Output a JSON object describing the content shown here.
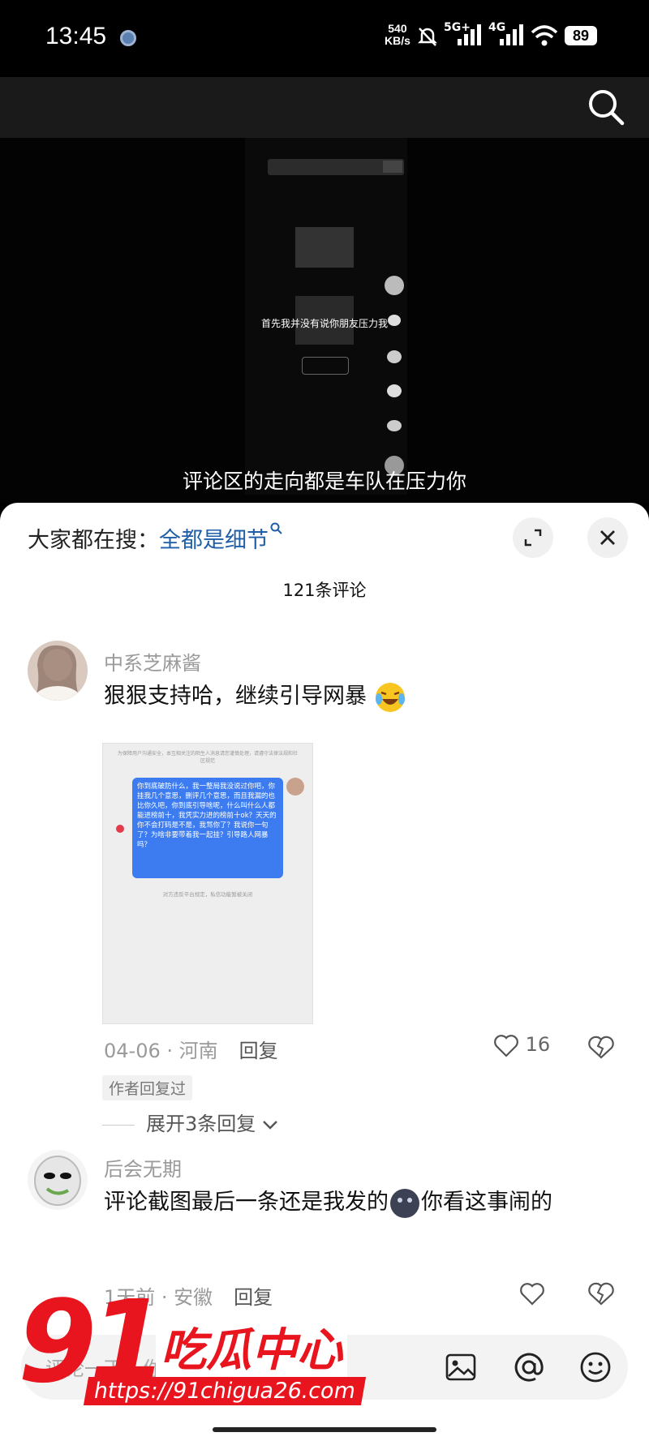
{
  "status_bar": {
    "time": "13:45",
    "net_speed_value": "540",
    "net_speed_unit": "KB/s",
    "signal1": "5G+",
    "signal2": "4G",
    "battery": "89"
  },
  "video": {
    "inner_subtitle": "首先我并没有说你朋友压力我",
    "caption": "评论区的走向都是车队在压力你"
  },
  "sheet": {
    "hot_prefix": "大家都在搜：",
    "hot_keyword": "全都是细节",
    "comment_count": "121条评论"
  },
  "comments": [
    {
      "username": "中系芝麻酱",
      "text": "狠狠支持哈，继续引导网暴",
      "meta": "04-06 · 河南",
      "reply_label": "回复",
      "likes": "16",
      "badge": "作者回复过",
      "expand": "展开3条回复",
      "screenshot": {
        "top_notice": "为保障用户沟通安全，本互相关注的陌生人消息请您谨慎处理，请遵守法律法规和社区规范",
        "bubble": "你到底破防什么，我一整局我没说过你吧，你挂我几个意思，删评几个意思，而且我漏的也比你久吧，你到底引导啥呢，什么叫什么人都能进榜前十，我凭实力进的榜前十ok？天天的你不会打码是不是，我骂你了？我说你一句了？为啥非要带着我一起挂？引导路人网暴吗？",
        "bottom_notice": "对方违反平台规定，私信功能暂被关闭"
      }
    },
    {
      "username": "后会无期",
      "text_part1": "评论截图最后一条还是我发的",
      "text_part2": "你看这事闹的",
      "meta": "1天前 · 安徽",
      "reply_label": "回复"
    }
  ],
  "input": {
    "placeholder": "评论一下，你想说的……"
  },
  "watermark": {
    "number": "91",
    "name": "吃瓜中心",
    "url": "https://91chigua26.com"
  }
}
